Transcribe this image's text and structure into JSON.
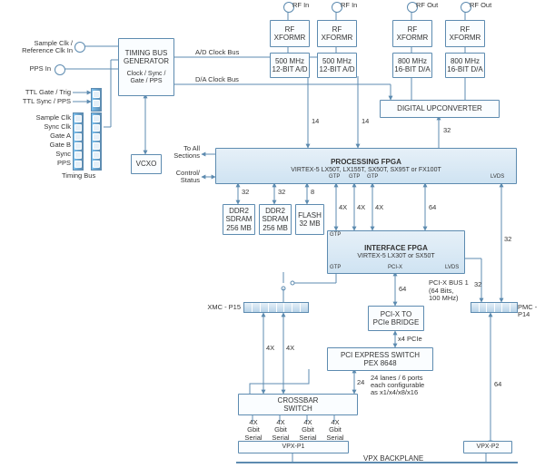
{
  "inputs": {
    "rfin1": "RF In",
    "rfin2": "RF In",
    "rfout1": "RF Out",
    "rfout2": "RF Out",
    "sample_clk": "Sample Clk /\nReference Clk In",
    "pps_in": "PPS In",
    "ttl_trig": "TTL Gate / Trig",
    "ttl_sync": "TTL Sync / PPS",
    "sig_sample": "Sample Clk",
    "sig_sync": "Sync Clk",
    "sig_gatea": "Gate A",
    "sig_gateb": "Gate B",
    "sig_syncb": "Sync",
    "sig_pps": "PPS",
    "timing_bus_lbl": "Timing Bus"
  },
  "blocks": {
    "timing_bus_gen_l1": "TIMING BUS",
    "timing_bus_gen_l2": "GENERATOR",
    "timing_sub_l1": "Clock / Sync /",
    "timing_sub_l2": "Gate / PPS",
    "vcxo": "VCXO",
    "rf_xformr": "RF\nXFORMR",
    "adc_l1": "500 MHz",
    "adc_l2": "12-BIT A/D",
    "dac_l1": "800 MHz",
    "dac_l2": "16-BIT D/A",
    "duc": "DIGITAL UPCONVERTER",
    "pfpga_l1": "PROCESSING FPGA",
    "pfpga_l2": "VIRTEX-5 LX50T, LX155T, SX50T, SX95T or FX100T",
    "ddr2_l1": "DDR2",
    "ddr2_l2": "SDRAM",
    "ddr2_l3": "256 MB",
    "flash_l1": "FLASH",
    "flash_l2": "32 MB",
    "ifpga_l1": "INTERFACE FPGA",
    "ifpga_l2": "VIRTEX-5  LX30T or SX50T",
    "pcix_bridge_l1": "PCI-X TO",
    "pcix_bridge_l2": "PCIe BRIDGE",
    "pcie_sw_l1": "PCI EXPRESS SWITCH",
    "pcie_sw_l2": "PEX 8648",
    "crossbar_l1": "CROSSBAR",
    "crossbar_l2": "SWITCH",
    "vpx_p1": "VPX-P1",
    "vpx_p2": "VPX-P2",
    "vpx_backplane": "VPX BACKPLANE",
    "xmc_p15": "XMC - P15",
    "pmc_p14": "PMC - P14"
  },
  "labels": {
    "ad_clock_bus": "A/D Clock Bus",
    "da_clock_bus": "D/A Clock Bus",
    "toall_l1": "To All",
    "toall_l2": "Sections",
    "ctrlstat_l1": "Control/",
    "ctrlstat_l2": "Status",
    "gtp": "GTP",
    "lvds": "LVDS",
    "pcix": "PCI-X",
    "pci_bus_l1": "PCI-X BUS 1",
    "pci_bus_l2": "(64 Bits,",
    "pci_bus_l3": "100 MHz)",
    "x4pcie": "x4 PCIe",
    "lanes_l1": "24 lanes / 6 ports",
    "lanes_l2": "each configurable",
    "lanes_l3": "as x1/x4/x8/x16",
    "gbit_l1": "4X",
    "gbit_l2": "Gbit",
    "gbit_l3": "Serial",
    "w14": "14",
    "w32a": "32",
    "w32b": "32",
    "w32c": "32",
    "w32d": "32",
    "w32e": "32",
    "w8": "8",
    "w4x": "4X",
    "w64a": "64",
    "w64b": "64",
    "w64c": "64",
    "w24": "24"
  }
}
